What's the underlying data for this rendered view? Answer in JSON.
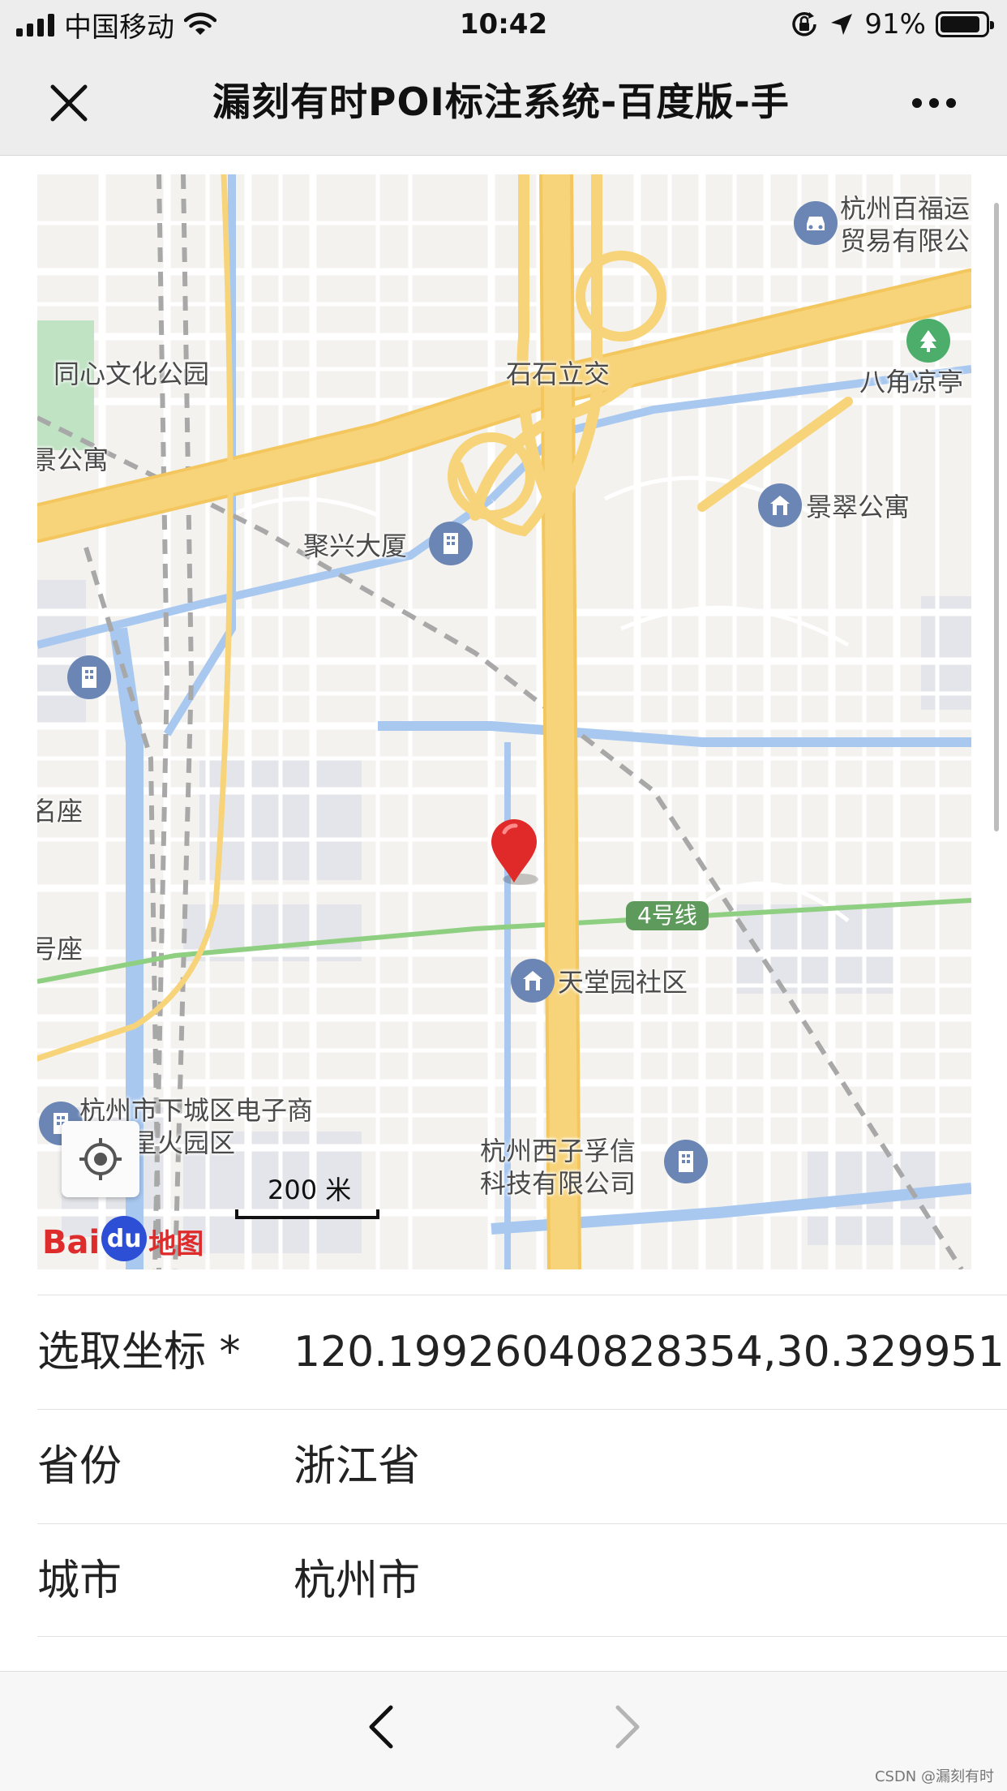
{
  "status_bar": {
    "carrier": "中国移动",
    "time": "10:42",
    "battery": "91%"
  },
  "nav": {
    "title": "漏刻有时POI标注系统-百度版-手"
  },
  "map": {
    "labels": {
      "hangzhou_baifu": "杭州百福运\n贸易有限公",
      "tongxin_park": "同心文化公园",
      "shishi_lijiao": "石石立交",
      "bajiao_pavilion": "八角凉亭",
      "jing_apartment": "景公寓",
      "jingcui_apartment": "景翠公寓",
      "juxing_building": "聚兴大厦",
      "left_zuo": "名座",
      "left_zuo2": "号座",
      "metro_line": "4号线",
      "tiantangyuan": "天堂园社区",
      "xiacheng_ecommerce": "杭州市下城区电子商\n业园星火园区",
      "xizifu": "杭州西子孚信\n科技有限公司"
    },
    "scale_label": "200 米",
    "logo": {
      "bai": "Bai",
      "du": "du",
      "map": "地图"
    }
  },
  "form": {
    "rows": [
      {
        "label": "选取坐标 *",
        "value": "120.19926040828354,30.329951"
      },
      {
        "label": "省份",
        "value": "浙江省"
      },
      {
        "label": "城市",
        "value": "杭州市"
      }
    ]
  },
  "watermark": "CSDN @漏刻有时",
  "colors": {
    "major_road": "#f7d47a",
    "water": "#a9c8f0",
    "metro": "#8fcf82",
    "marker": "#e02a2a",
    "poi_blue": "#6b86b4",
    "poi_green": "#4cae6a"
  }
}
